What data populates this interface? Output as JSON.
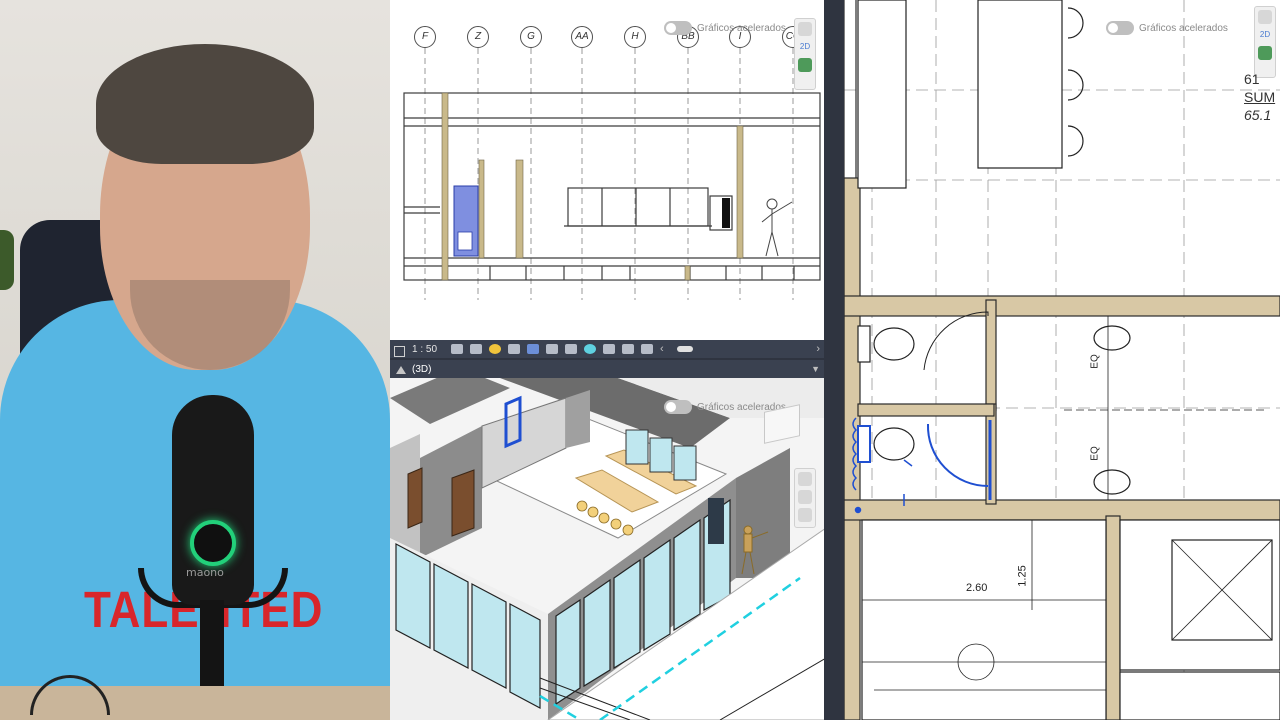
{
  "webcam": {
    "shirt_text": "TALENTED",
    "mic_brand": "maono"
  },
  "elevation_view": {
    "grid_labels": [
      "F",
      "Z",
      "G",
      "AA",
      "H",
      "BB",
      "I",
      "CC"
    ],
    "accelerated_graphics_label": "Gráficos acelerados",
    "nav_mode": "2D"
  },
  "view_control_bar": {
    "scale": "1 : 50"
  },
  "view_3d": {
    "title": "(3D)",
    "accelerated_graphics_label": "Gráficos acelerados"
  },
  "plan_view": {
    "accelerated_graphics_label": "Gráficos acelerados",
    "nav_mode": "2D",
    "room_number": "61",
    "room_name": "SUM",
    "room_area": "65.1",
    "dim_width": "2.60",
    "dim_height": "1.25",
    "eq_top": "EQ",
    "eq_bottom": "EQ"
  },
  "colors": {
    "wall_fill": "#d8c8a5",
    "selection_blue": "#1f4fd1",
    "ui_dark": "#3a4150",
    "glass": "#bfe7ef"
  }
}
